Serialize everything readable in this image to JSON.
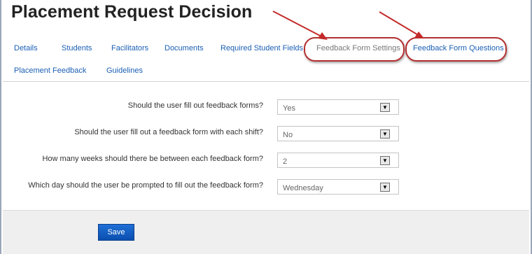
{
  "page": {
    "title": "Placement Request Decision"
  },
  "tabs": [
    {
      "label": "Details"
    },
    {
      "label": "Students"
    },
    {
      "label": "Facilitators"
    },
    {
      "label": "Documents"
    },
    {
      "label": "Required Student Fields"
    },
    {
      "label": "Feedback Form Settings",
      "active": true
    },
    {
      "label": "Feedback Form Questions"
    },
    {
      "label": "Placement Feedback"
    },
    {
      "label": "Guidelines"
    }
  ],
  "form": {
    "questions": [
      {
        "label": "Should the user fill out feedback forms?",
        "value": "Yes"
      },
      {
        "label": "Should the user fill out a feedback form with each shift?",
        "value": "No"
      },
      {
        "label": "How many weeks should there be between each feedback form?",
        "value": "2"
      },
      {
        "label": "Which day should the user be prompted to fill out the feedback form?",
        "value": "Wednesday"
      }
    ],
    "save_label": "Save"
  },
  "icons": {
    "dropdown": "chevron-down-icon",
    "annotation": "red-arrow-icon"
  },
  "colors": {
    "annotation": "#b23030",
    "link": "#1a5fb4",
    "save_button": "#1560c4"
  }
}
